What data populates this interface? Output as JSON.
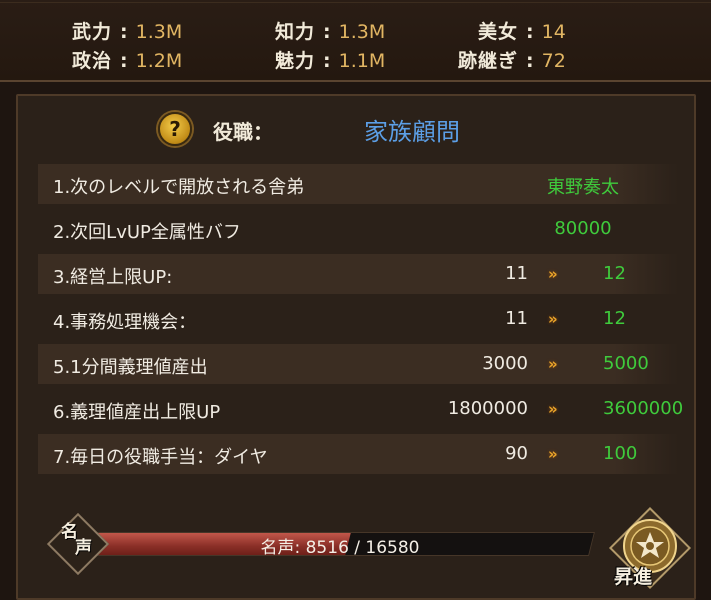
{
  "stats": [
    {
      "name": "武力",
      "value": "1.3M"
    },
    {
      "name": "知力",
      "value": "1.3M"
    },
    {
      "name": "美女",
      "value": "14"
    },
    {
      "name": "政治",
      "value": "1.2M"
    },
    {
      "name": "魅力",
      "value": "1.1M"
    },
    {
      "name": "跡継ぎ",
      "value": "72"
    }
  ],
  "stat_sep": ":",
  "post": {
    "label": "役職：",
    "value": "家族顧問",
    "help_icon": "question-mark-icon"
  },
  "rows": [
    {
      "label": "1.次のレベルで開放される舎弟",
      "value": "東野奏太"
    },
    {
      "label": "2.次回LvUP全属性バフ",
      "value": "80000"
    },
    {
      "label": "3.経営上限UP:",
      "current": "11",
      "next": "12"
    },
    {
      "label": "4.事務処理機会：",
      "current": "11",
      "next": "12"
    },
    {
      "label": "5.1分間義理値産出",
      "current": "3000",
      "next": "5000"
    },
    {
      "label": "6.義理値産出上限UP",
      "current": "1800000",
      "next": "3600000"
    },
    {
      "label": "7.毎日の役職手当：ダイヤ",
      "current": "90",
      "next": "100"
    }
  ],
  "arrow": "»",
  "fame": {
    "badge_line1": "名",
    "badge_line2": "声",
    "text": "名声: 8516 / 16580",
    "progress": 0.514
  },
  "promote": {
    "label": "昇進",
    "icon": "family-crest-icon"
  },
  "colors": {
    "accent_gold": "#e2b663",
    "value_green": "#3fcb3c",
    "title_blue": "#5c9fe6",
    "arrow_orange": "#e8a42a"
  }
}
